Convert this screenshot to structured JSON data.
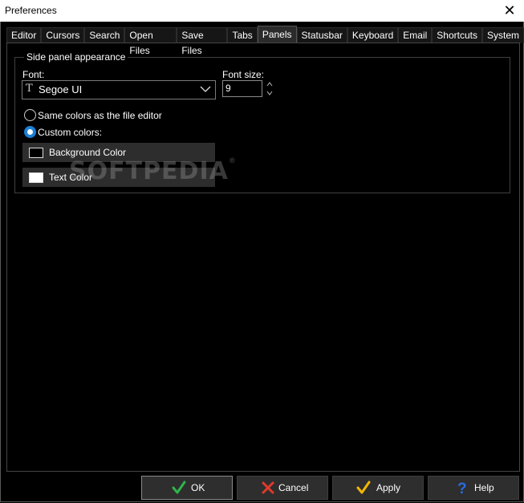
{
  "window": {
    "title": "Preferences"
  },
  "tabs": [
    {
      "label": "Editor"
    },
    {
      "label": "Cursors"
    },
    {
      "label": "Search"
    },
    {
      "label": "Open Files"
    },
    {
      "label": "Save Files"
    },
    {
      "label": "Tabs"
    },
    {
      "label": "Panels",
      "active": true
    },
    {
      "label": "Statusbar"
    },
    {
      "label": "Keyboard"
    },
    {
      "label": "Email"
    },
    {
      "label": "Shortcuts"
    },
    {
      "label": "System"
    }
  ],
  "panel": {
    "group_label": "Side panel appearance",
    "font_label": "Font:",
    "font_value": "Segoe UI",
    "font_size_label": "Font size:",
    "font_size_value": "9",
    "radio_same": "Same colors as the file editor",
    "radio_custom": "Custom colors:",
    "selected_radio": "custom",
    "bg_color_button": "Background Color",
    "bg_color": "#000000",
    "text_color_button": "Text Color",
    "text_color": "#ffffff"
  },
  "watermark": {
    "text": "SOFTPEDIA",
    "mark": "®"
  },
  "footer": {
    "ok": "OK",
    "cancel": "Cancel",
    "apply": "Apply",
    "help": "Help"
  },
  "colors": {
    "ok_icon": "#2fb34a",
    "cancel_icon": "#e03a2b",
    "apply_icon": "#f2b600",
    "help_icon": "#2a6be0",
    "radio_accent": "#1b7fd6"
  }
}
